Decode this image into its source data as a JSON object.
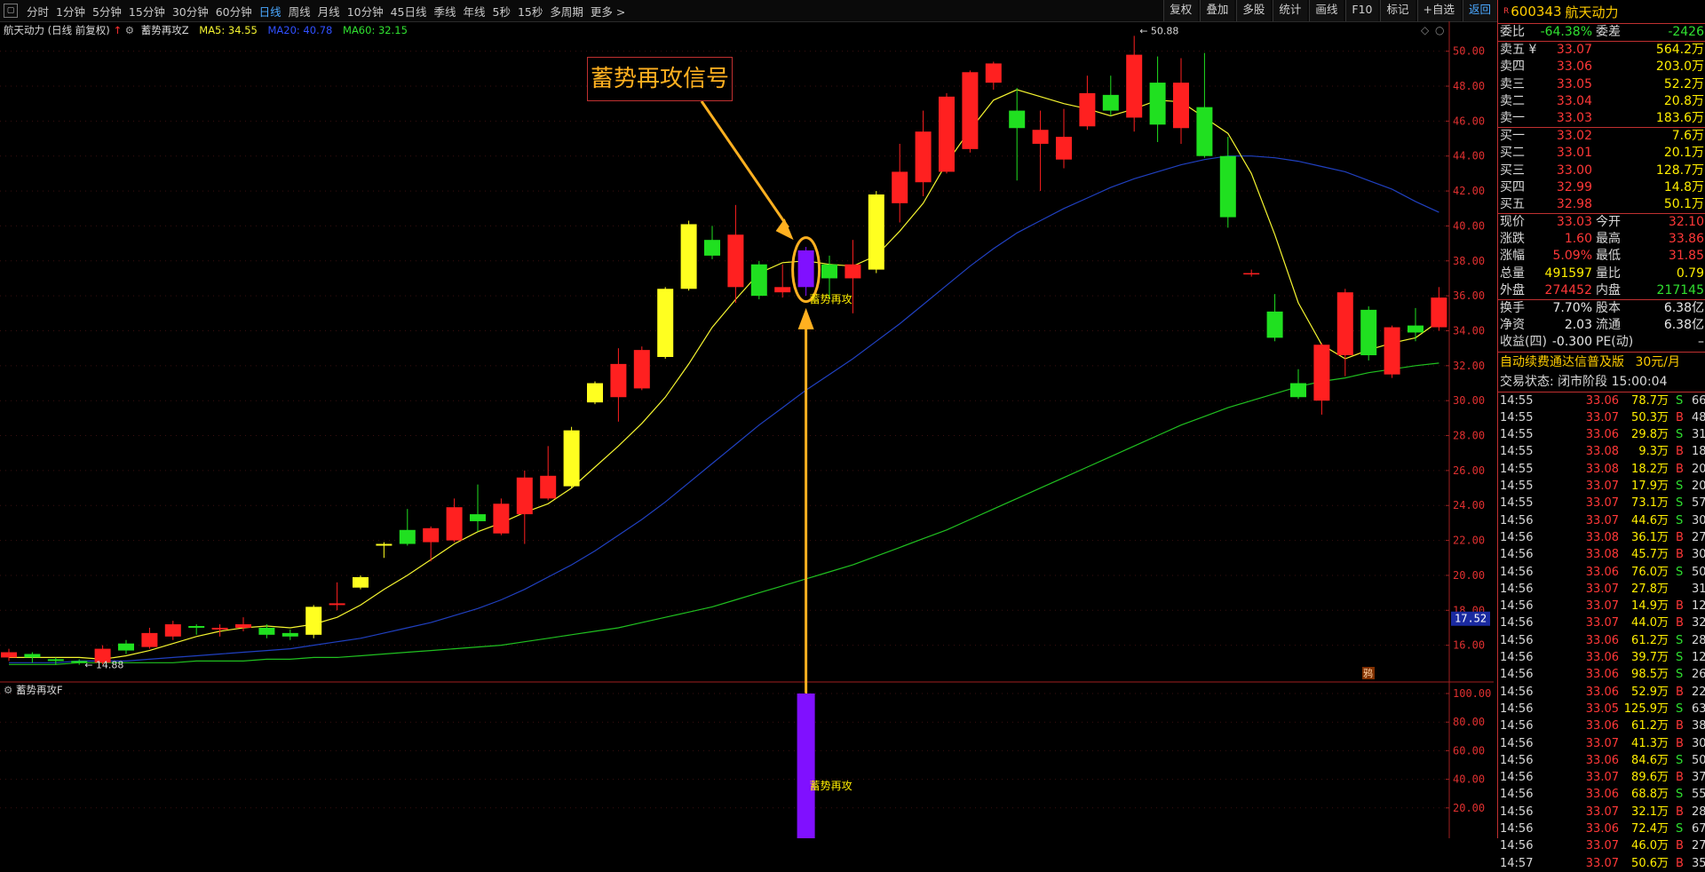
{
  "toolbar": {
    "timeframes": [
      "分时",
      "1分钟",
      "5分钟",
      "15分钟",
      "30分钟",
      "60分钟",
      "日线",
      "周线",
      "月线",
      "10分钟",
      "45日线",
      "季线",
      "年线",
      "5秒",
      "15秒",
      "多周期",
      "更多 >"
    ],
    "active_timeframe": "日线",
    "right_buttons": [
      "复权",
      "叠加",
      "多股",
      "统计",
      "画线",
      "F10",
      "标记",
      "+自选",
      "返回"
    ]
  },
  "main_title": {
    "stock": "航天动力 (日线 前复权)",
    "indicator": "蓄势再攻Z",
    "ma5": "MA5: 34.55",
    "ma20": "MA20: 40.78",
    "ma60": "MA60: 32.15"
  },
  "sub_title": "蓄势再攻F",
  "callout": "蓄势再攻信号",
  "colors": {
    "up": "#ff2020",
    "down": "#20e020",
    "signal": "#8010ff",
    "ma5": "#f5f530",
    "ma20": "#2040c0",
    "ma60": "#20c020",
    "arrow": "#ffb020"
  },
  "chart_data": {
    "type": "candlestick",
    "price_axis": {
      "min": 14,
      "max": 51,
      "ticks": [
        16.0,
        18.0,
        20.0,
        22.0,
        24.0,
        26.0,
        28.0,
        30.0,
        32.0,
        34.0,
        36.0,
        38.0,
        40.0,
        42.0,
        44.0,
        46.0,
        48.0,
        50.0
      ]
    },
    "candles": [
      {
        "o": 15.3,
        "c": 15.6,
        "h": 15.8,
        "l": 15.1,
        "color": "red"
      },
      {
        "o": 15.5,
        "c": 15.3,
        "h": 15.6,
        "l": 15.0,
        "color": "green"
      },
      {
        "o": 15.2,
        "c": 15.1,
        "h": 15.3,
        "l": 14.9,
        "color": "green"
      },
      {
        "o": 15.1,
        "c": 15.0,
        "h": 15.2,
        "l": 14.88,
        "color": "green"
      },
      {
        "o": 15.0,
        "c": 15.8,
        "h": 16.0,
        "l": 14.9,
        "color": "red"
      },
      {
        "o": 15.7,
        "c": 16.1,
        "h": 16.3,
        "l": 15.5,
        "color": "green"
      },
      {
        "o": 15.9,
        "c": 16.7,
        "h": 17.0,
        "l": 15.8,
        "color": "red"
      },
      {
        "o": 16.5,
        "c": 17.2,
        "h": 17.4,
        "l": 16.3,
        "color": "red"
      },
      {
        "o": 17.0,
        "c": 17.1,
        "h": 17.2,
        "l": 16.6,
        "color": "green"
      },
      {
        "o": 16.9,
        "c": 17.0,
        "h": 17.2,
        "l": 16.5,
        "color": "red"
      },
      {
        "o": 17.0,
        "c": 17.2,
        "h": 17.6,
        "l": 16.8,
        "color": "red"
      },
      {
        "o": 17.0,
        "c": 16.6,
        "h": 17.2,
        "l": 16.4,
        "color": "green"
      },
      {
        "o": 16.5,
        "c": 16.7,
        "h": 16.9,
        "l": 16.3,
        "color": "green"
      },
      {
        "o": 16.6,
        "c": 18.2,
        "h": 18.3,
        "l": 16.4,
        "color": "yellow"
      },
      {
        "o": 18.3,
        "c": 18.4,
        "h": 19.6,
        "l": 18.0,
        "color": "red"
      },
      {
        "o": 19.3,
        "c": 19.9,
        "h": 20.0,
        "l": 19.2,
        "color": "yellow"
      },
      {
        "o": 21.7,
        "c": 21.8,
        "h": 21.9,
        "l": 21.0,
        "color": "yellow"
      },
      {
        "o": 21.8,
        "c": 22.6,
        "h": 23.8,
        "l": 21.7,
        "color": "green"
      },
      {
        "o": 21.9,
        "c": 22.7,
        "h": 22.8,
        "l": 20.8,
        "color": "red"
      },
      {
        "o": 22.0,
        "c": 23.9,
        "h": 24.4,
        "l": 21.9,
        "color": "red"
      },
      {
        "o": 23.5,
        "c": 23.1,
        "h": 25.2,
        "l": 22.5,
        "color": "green"
      },
      {
        "o": 22.4,
        "c": 24.1,
        "h": 24.4,
        "l": 22.3,
        "color": "red"
      },
      {
        "o": 23.5,
        "c": 25.6,
        "h": 26.0,
        "l": 21.8,
        "color": "red"
      },
      {
        "o": 24.4,
        "c": 25.7,
        "h": 27.4,
        "l": 24.3,
        "color": "red"
      },
      {
        "o": 25.1,
        "c": 28.3,
        "h": 28.5,
        "l": 25.0,
        "color": "yellow"
      },
      {
        "o": 29.9,
        "c": 31.0,
        "h": 31.1,
        "l": 29.8,
        "color": "yellow"
      },
      {
        "o": 30.2,
        "c": 32.1,
        "h": 33.0,
        "l": 28.8,
        "color": "red"
      },
      {
        "o": 30.7,
        "c": 32.9,
        "h": 33.1,
        "l": 30.6,
        "color": "red"
      },
      {
        "o": 32.5,
        "c": 36.4,
        "h": 36.5,
        "l": 32.4,
        "color": "yellow"
      },
      {
        "o": 36.4,
        "c": 40.1,
        "h": 40.3,
        "l": 36.3,
        "color": "yellow"
      },
      {
        "o": 38.3,
        "c": 39.2,
        "h": 40.0,
        "l": 38.1,
        "color": "green"
      },
      {
        "o": 36.5,
        "c": 39.5,
        "h": 41.2,
        "l": 35.6,
        "color": "red"
      },
      {
        "o": 37.8,
        "c": 36.0,
        "h": 38.0,
        "l": 35.8,
        "color": "green"
      },
      {
        "o": 36.2,
        "c": 36.5,
        "h": 37.8,
        "l": 35.9,
        "color": "red"
      },
      {
        "o": 36.5,
        "c": 38.6,
        "h": 38.8,
        "l": 36.0,
        "color": "purple"
      },
      {
        "o": 37.8,
        "c": 37.0,
        "h": 38.3,
        "l": 35.8,
        "color": "green"
      },
      {
        "o": 37.0,
        "c": 37.8,
        "h": 39.2,
        "l": 35.0,
        "color": "red"
      },
      {
        "o": 37.5,
        "c": 41.8,
        "h": 42.0,
        "l": 37.3,
        "color": "yellow"
      },
      {
        "o": 41.3,
        "c": 43.1,
        "h": 44.7,
        "l": 40.2,
        "color": "red"
      },
      {
        "o": 42.5,
        "c": 45.4,
        "h": 46.6,
        "l": 41.7,
        "color": "red"
      },
      {
        "o": 43.1,
        "c": 47.4,
        "h": 47.6,
        "l": 43.0,
        "color": "red"
      },
      {
        "o": 44.4,
        "c": 48.8,
        "h": 48.9,
        "l": 44.2,
        "color": "red"
      },
      {
        "o": 48.2,
        "c": 49.3,
        "h": 49.4,
        "l": 47.8,
        "color": "red"
      },
      {
        "o": 46.6,
        "c": 45.6,
        "h": 47.9,
        "l": 42.6,
        "color": "green"
      },
      {
        "o": 44.7,
        "c": 45.5,
        "h": 46.6,
        "l": 42.0,
        "color": "red"
      },
      {
        "o": 43.8,
        "c": 45.1,
        "h": 46.7,
        "l": 43.3,
        "color": "red"
      },
      {
        "o": 45.7,
        "c": 47.6,
        "h": 48.6,
        "l": 45.5,
        "color": "red"
      },
      {
        "o": 47.5,
        "c": 46.6,
        "h": 48.6,
        "l": 46.3,
        "color": "green"
      },
      {
        "o": 46.2,
        "c": 49.8,
        "h": 50.88,
        "l": 45.4,
        "color": "red"
      },
      {
        "o": 48.2,
        "c": 45.8,
        "h": 49.7,
        "l": 44.8,
        "color": "green"
      },
      {
        "o": 45.6,
        "c": 48.2,
        "h": 49.6,
        "l": 44.7,
        "color": "red"
      },
      {
        "o": 46.8,
        "c": 44.0,
        "h": 49.9,
        "l": 43.9,
        "color": "green"
      },
      {
        "o": 44.0,
        "c": 40.5,
        "h": 45.1,
        "l": 39.9,
        "color": "green"
      },
      {
        "o": 37.3,
        "c": 37.3,
        "h": 37.5,
        "l": 37.1,
        "color": "red"
      },
      {
        "o": 35.1,
        "c": 33.6,
        "h": 36.1,
        "l": 33.4,
        "color": "green"
      },
      {
        "o": 31.0,
        "c": 30.2,
        "h": 31.8,
        "l": 30.1,
        "color": "green"
      },
      {
        "o": 30.0,
        "c": 33.2,
        "h": 33.3,
        "l": 29.2,
        "color": "red"
      },
      {
        "o": 32.6,
        "c": 36.2,
        "h": 36.4,
        "l": 31.4,
        "color": "red"
      },
      {
        "o": 35.2,
        "c": 32.6,
        "h": 35.4,
        "l": 32.3,
        "color": "green"
      },
      {
        "o": 31.5,
        "c": 34.2,
        "h": 34.3,
        "l": 31.3,
        "color": "red"
      },
      {
        "o": 34.3,
        "c": 33.9,
        "h": 35.3,
        "l": 33.4,
        "color": "green"
      },
      {
        "o": 34.2,
        "c": 35.9,
        "h": 36.5,
        "l": 34.0,
        "color": "red"
      }
    ],
    "ma5": [
      15.3,
      15.3,
      15.3,
      15.3,
      15.2,
      15.4,
      15.7,
      16.1,
      16.5,
      16.8,
      17.0,
      17.1,
      17.0,
      17.2,
      17.6,
      18.3,
      19.2,
      20.0,
      20.9,
      21.8,
      22.5,
      23.0,
      23.6,
      24.1,
      25.0,
      26.2,
      27.4,
      28.7,
      30.2,
      32.1,
      34.2,
      35.8,
      37.3,
      37.9,
      38.0,
      37.8,
      37.7,
      38.3,
      39.7,
      41.3,
      43.6,
      45.5,
      47.2,
      47.8,
      47.4,
      47.0,
      46.7,
      46.3,
      46.7,
      47.2,
      47.1,
      46.2,
      45.3,
      43.0,
      39.5,
      35.6,
      33.2,
      32.4,
      32.9,
      33.3,
      33.6,
      34.55
    ],
    "ma20": [
      15.0,
      15.0,
      15.0,
      15.1,
      15.1,
      15.1,
      15.2,
      15.3,
      15.4,
      15.5,
      15.6,
      15.7,
      15.8,
      16.0,
      16.2,
      16.4,
      16.7,
      17.0,
      17.3,
      17.7,
      18.1,
      18.6,
      19.2,
      19.9,
      20.6,
      21.4,
      22.3,
      23.2,
      24.2,
      25.3,
      26.4,
      27.5,
      28.6,
      29.6,
      30.6,
      31.5,
      32.4,
      33.4,
      34.4,
      35.5,
      36.6,
      37.7,
      38.7,
      39.6,
      40.3,
      41.0,
      41.6,
      42.2,
      42.7,
      43.1,
      43.5,
      43.8,
      44.0,
      44.0,
      43.9,
      43.7,
      43.4,
      43.1,
      42.6,
      42.1,
      41.4,
      40.78
    ],
    "ma60": [
      14.9,
      14.9,
      14.9,
      15.0,
      15.0,
      15.0,
      15.0,
      15.0,
      15.1,
      15.1,
      15.1,
      15.2,
      15.2,
      15.3,
      15.3,
      15.4,
      15.5,
      15.6,
      15.7,
      15.8,
      15.9,
      16.0,
      16.2,
      16.4,
      16.6,
      16.8,
      17.0,
      17.3,
      17.6,
      17.9,
      18.2,
      18.6,
      19.0,
      19.4,
      19.8,
      20.2,
      20.6,
      21.1,
      21.6,
      22.1,
      22.6,
      23.2,
      23.8,
      24.4,
      25.0,
      25.6,
      26.2,
      26.8,
      27.4,
      28.0,
      28.6,
      29.1,
      29.6,
      30.0,
      30.4,
      30.8,
      31.1,
      31.3,
      31.6,
      31.8,
      32.0,
      32.15
    ],
    "annotations": {
      "high_label": "50.88",
      "low_label": "14.88",
      "signal_label": "蓄势再攻",
      "current_price_tag": "17.52",
      "badge": "鸦"
    },
    "sub_chart": {
      "title": "蓄势再攻F",
      "ticks": [
        20.0,
        40.0,
        60.0,
        80.0,
        100.0
      ],
      "signal_value": 100,
      "signal_label": "蓄势再攻"
    }
  },
  "panel": {
    "code": "600343",
    "name": "航天动力",
    "weibi_label": "委比",
    "weibi": "-64.38%",
    "weicha_label": "委差",
    "weicha": "-2426",
    "asks": [
      {
        "label": "卖五 ¥",
        "price": "33.07",
        "vol": "564.2万"
      },
      {
        "label": "卖四",
        "price": "33.06",
        "vol": "203.0万"
      },
      {
        "label": "卖三",
        "price": "33.05",
        "vol": "52.2万"
      },
      {
        "label": "卖二",
        "price": "33.04",
        "vol": "20.8万"
      },
      {
        "label": "卖一",
        "price": "33.03",
        "vol": "183.6万"
      }
    ],
    "bids": [
      {
        "label": "买一",
        "price": "33.02",
        "vol": "7.6万"
      },
      {
        "label": "买二",
        "price": "33.01",
        "vol": "20.1万"
      },
      {
        "label": "买三",
        "price": "33.00",
        "vol": "128.7万"
      },
      {
        "label": "买四",
        "price": "32.99",
        "vol": "14.8万"
      },
      {
        "label": "买五",
        "price": "32.98",
        "vol": "50.1万"
      }
    ],
    "stats": [
      {
        "l1": "现价",
        "v1": "33.03",
        "c1": "red",
        "l2": "今开",
        "v2": "32.10",
        "c2": "red"
      },
      {
        "l1": "涨跌",
        "v1": "1.60",
        "c1": "red",
        "l2": "最高",
        "v2": "33.86",
        "c2": "red"
      },
      {
        "l1": "涨幅",
        "v1": "5.09%",
        "c1": "red",
        "l2": "最低",
        "v2": "31.85",
        "c2": "red"
      },
      {
        "l1": "总量",
        "v1": "491597",
        "c1": "yel",
        "l2": "量比",
        "v2": "0.79",
        "c2": "yel"
      },
      {
        "l1": "外盘",
        "v1": "274452",
        "c1": "red",
        "l2": "内盘",
        "v2": "217145",
        "c2": "grn"
      }
    ],
    "stats2": [
      {
        "l1": "换手",
        "v1": "7.70%",
        "l2": "股本",
        "v2": "6.38亿"
      },
      {
        "l1": "净资",
        "v1": "2.03",
        "l2": "流通",
        "v2": "6.38亿"
      },
      {
        "l1": "收益(四)",
        "v1": "-0.300",
        "l2": "PE(动)",
        "v2": "–"
      }
    ],
    "ad_text": "自动续费通达信普及版",
    "ad_price": "30元/月",
    "trade_state": "交易状态: 闭市阶段 15:00:04",
    "ticks": [
      {
        "t": "14:55",
        "p": "33.06",
        "pc": "red",
        "v": "78.7万",
        "bs": "S",
        "n": "66"
      },
      {
        "t": "14:55",
        "p": "33.07",
        "pc": "red",
        "v": "50.3万",
        "bs": "B",
        "n": "48"
      },
      {
        "t": "14:55",
        "p": "33.06",
        "pc": "red",
        "v": "29.8万",
        "bs": "S",
        "n": "31"
      },
      {
        "t": "14:55",
        "p": "33.08",
        "pc": "red",
        "v": "9.3万",
        "bs": "B",
        "n": "18"
      },
      {
        "t": "14:55",
        "p": "33.08",
        "pc": "red",
        "v": "18.2万",
        "bs": "B",
        "n": "20"
      },
      {
        "t": "14:55",
        "p": "33.07",
        "pc": "red",
        "v": "17.9万",
        "bs": "S",
        "n": "20"
      },
      {
        "t": "14:55",
        "p": "33.07",
        "pc": "red",
        "v": "73.1万",
        "bs": "S",
        "n": "57"
      },
      {
        "t": "14:56",
        "p": "33.07",
        "pc": "red",
        "v": "44.6万",
        "bs": "S",
        "n": "30"
      },
      {
        "t": "14:56",
        "p": "33.08",
        "pc": "red",
        "v": "36.1万",
        "bs": "B",
        "n": "27"
      },
      {
        "t": "14:56",
        "p": "33.08",
        "pc": "red",
        "v": "45.7万",
        "bs": "B",
        "n": "30"
      },
      {
        "t": "14:56",
        "p": "33.06",
        "pc": "red",
        "v": "76.0万",
        "bs": "S",
        "n": "50"
      },
      {
        "t": "14:56",
        "p": "33.07",
        "pc": "red",
        "v": "27.8万",
        "bs": "",
        "n": "31"
      },
      {
        "t": "14:56",
        "p": "33.07",
        "pc": "red",
        "v": "14.9万",
        "bs": "B",
        "n": "12"
      },
      {
        "t": "14:56",
        "p": "33.07",
        "pc": "red",
        "v": "44.0万",
        "bs": "B",
        "n": "32"
      },
      {
        "t": "14:56",
        "p": "33.06",
        "pc": "red",
        "v": "61.2万",
        "bs": "S",
        "n": "28"
      },
      {
        "t": "14:56",
        "p": "33.06",
        "pc": "red",
        "v": "39.7万",
        "bs": "S",
        "n": "12"
      },
      {
        "t": "14:56",
        "p": "33.06",
        "pc": "red",
        "v": "98.5万",
        "bs": "S",
        "n": "26"
      },
      {
        "t": "14:56",
        "p": "33.06",
        "pc": "red",
        "v": "52.9万",
        "bs": "B",
        "n": "22"
      },
      {
        "t": "14:56",
        "p": "33.05",
        "pc": "red",
        "v": "125.9万",
        "bs": "S",
        "n": "63"
      },
      {
        "t": "14:56",
        "p": "33.06",
        "pc": "red",
        "v": "61.2万",
        "bs": "B",
        "n": "38"
      },
      {
        "t": "14:56",
        "p": "33.07",
        "pc": "red",
        "v": "41.3万",
        "bs": "B",
        "n": "30"
      },
      {
        "t": "14:56",
        "p": "33.06",
        "pc": "red",
        "v": "84.6万",
        "bs": "S",
        "n": "50"
      },
      {
        "t": "14:56",
        "p": "33.07",
        "pc": "red",
        "v": "89.6万",
        "bs": "B",
        "n": "37"
      },
      {
        "t": "14:56",
        "p": "33.06",
        "pc": "red",
        "v": "68.8万",
        "bs": "S",
        "n": "55"
      },
      {
        "t": "14:56",
        "p": "33.07",
        "pc": "red",
        "v": "32.1万",
        "bs": "B",
        "n": "28"
      },
      {
        "t": "14:56",
        "p": "33.06",
        "pc": "red",
        "v": "72.4万",
        "bs": "S",
        "n": "67"
      },
      {
        "t": "14:56",
        "p": "33.07",
        "pc": "red",
        "v": "46.0万",
        "bs": "B",
        "n": "27"
      },
      {
        "t": "14:57",
        "p": "33.07",
        "pc": "red",
        "v": "50.6万",
        "bs": "B",
        "n": "35"
      }
    ]
  }
}
